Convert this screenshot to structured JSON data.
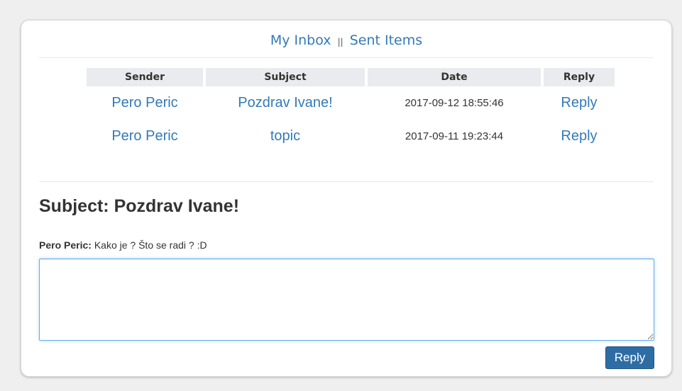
{
  "nav": {
    "inbox_label": "My Inbox",
    "separator": "||",
    "sent_label": "Sent Items"
  },
  "table": {
    "headers": [
      "Sender",
      "Subject",
      "Date",
      "Reply"
    ],
    "rows": [
      {
        "sender": "Pero Peric",
        "subject": "Pozdrav Ivane!",
        "date": "2017-09-12 18:55:46",
        "reply": "Reply"
      },
      {
        "sender": "Pero Peric",
        "subject": "topic",
        "date": "2017-09-11 19:23:44",
        "reply": "Reply"
      }
    ]
  },
  "message": {
    "heading": "Subject: Pozdrav Ivane!",
    "author": "Pero Peric:",
    "body": "Kako je ? Što se radi ? :D"
  },
  "reply_form": {
    "textarea_value": "",
    "button_label": "Reply"
  },
  "colors": {
    "link": "#337ab7",
    "button": "#2e6da4",
    "header_bg": "#e9ebee"
  }
}
